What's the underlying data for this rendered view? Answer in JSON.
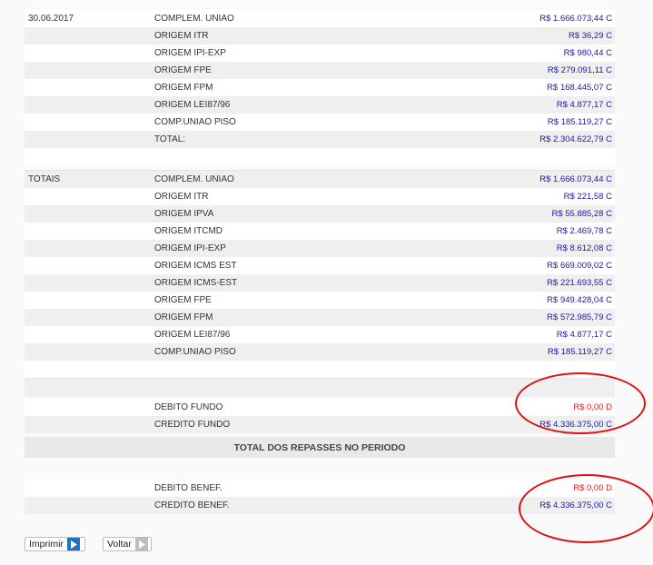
{
  "section1": {
    "date": "30.06.2017",
    "rows": [
      {
        "label": "COMPLEM. UNIAO",
        "value": "R$ 1.666.073,44 C"
      },
      {
        "label": "ORIGEM ITR",
        "value": "R$ 36,29 C"
      },
      {
        "label": "ORIGEM IPI-EXP",
        "value": "R$ 980,44 C"
      },
      {
        "label": "ORIGEM FPE",
        "value": "R$ 279.091,11 C"
      },
      {
        "label": "ORIGEM FPM",
        "value": "R$ 168.445,07 C"
      },
      {
        "label": "ORIGEM LEI87/96",
        "value": "R$ 4.877,17 C"
      },
      {
        "label": "COMP.UNIAO PISO",
        "value": "R$ 185.119,27 C"
      },
      {
        "label": "TOTAL:",
        "value": "R$ 2.304.622,79 C"
      }
    ]
  },
  "section2": {
    "label": "TOTAIS",
    "rows": [
      {
        "label": "COMPLEM. UNIAO",
        "value": "R$ 1.666.073,44 C"
      },
      {
        "label": "ORIGEM ITR",
        "value": "R$ 221,58 C"
      },
      {
        "label": "ORIGEM IPVA",
        "value": "R$ 55.885,28 C"
      },
      {
        "label": "ORIGEM ITCMD",
        "value": "R$ 2.469,78 C"
      },
      {
        "label": "ORIGEM IPI-EXP",
        "value": "R$ 8.612,08 C"
      },
      {
        "label": "ORIGEM ICMS EST",
        "value": "R$ 669.009,02 C"
      },
      {
        "label": "ORIGEM ICMS-EST",
        "value": "R$ 221.693,55 C"
      },
      {
        "label": "ORIGEM FPE",
        "value": "R$ 949.428,04 C"
      },
      {
        "label": "ORIGEM FPM",
        "value": "R$ 572.985,79 C"
      },
      {
        "label": "ORIGEM LEI87/96",
        "value": "R$ 4.877,17 C"
      },
      {
        "label": "COMP.UNIAO PISO",
        "value": "R$ 185.119,27 C"
      }
    ]
  },
  "fundo": {
    "debito_label": "DEBITO FUNDO",
    "debito_value": "R$ 0,00 D",
    "credito_label": "CREDITO FUNDO",
    "credito_value": "R$ 4.336.375,00 C"
  },
  "header_title": "TOTAL DOS REPASSES NO PERIODO",
  "benef": {
    "debito_label": "DEBITO BENEF.",
    "debito_value": "R$ 0,00 D",
    "credito_label": "CREDITO BENEF.",
    "credito_value": "R$ 4.336.375,00 C"
  },
  "buttons": {
    "print": "Imprimir",
    "back": "Voltar"
  },
  "colors": {
    "credit": "#1a1aa6",
    "debit": "#e02020",
    "annotation": "#e01010",
    "print_icon": "#1e73be",
    "back_icon": "#bdbdbd"
  }
}
